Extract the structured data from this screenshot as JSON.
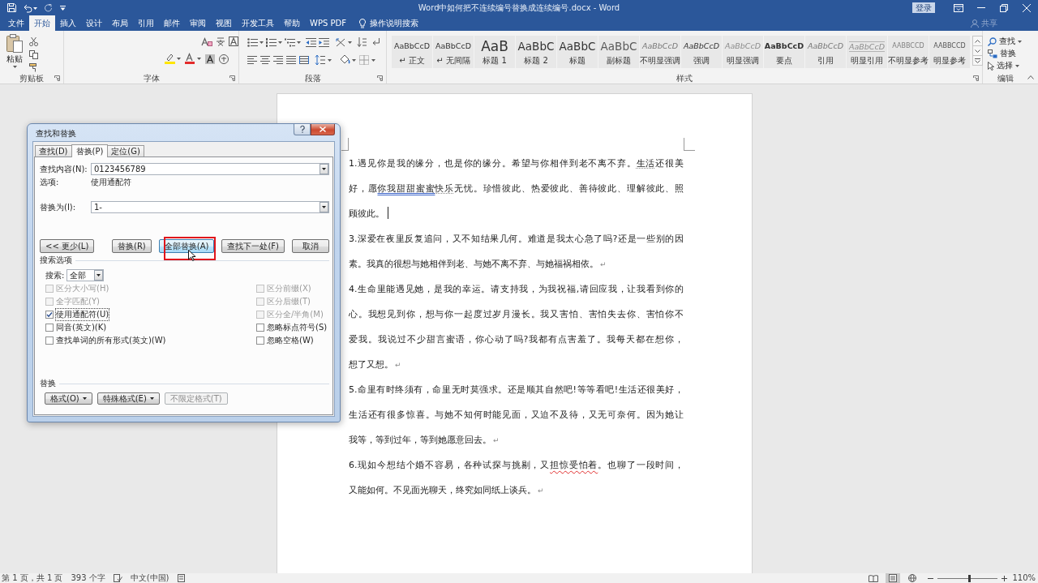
{
  "title_bar": {
    "title": "Word中如何把不连续编号替换成连续编号.docx - Word",
    "sign_in": "登录"
  },
  "ribbon_tabs": [
    {
      "label": "文件",
      "selected": false
    },
    {
      "label": "开始",
      "selected": true
    },
    {
      "label": "插入",
      "selected": false
    },
    {
      "label": "设计",
      "selected": false
    },
    {
      "label": "布局",
      "selected": false
    },
    {
      "label": "引用",
      "selected": false
    },
    {
      "label": "邮件",
      "selected": false
    },
    {
      "label": "审阅",
      "selected": false
    },
    {
      "label": "视图",
      "selected": false
    },
    {
      "label": "开发工具",
      "selected": false
    },
    {
      "label": "帮助",
      "selected": false
    },
    {
      "label": "WPS PDF",
      "selected": false
    }
  ],
  "tell_me": "操作说明搜索",
  "share": "共享",
  "ribbon": {
    "clipboard": {
      "paste": "粘贴",
      "label": "剪贴板"
    },
    "font": {
      "label": "字体"
    },
    "paragraph": {
      "label": "段落"
    },
    "styles": {
      "label": "样式",
      "items": [
        {
          "preview": "AaBbCcD",
          "name": "↵ 正文",
          "kind": "body"
        },
        {
          "preview": "AaBbCcD",
          "name": "↵ 无间隔",
          "kind": "body"
        },
        {
          "preview": "AaB",
          "name": "标题 1",
          "kind": "heading1"
        },
        {
          "preview": "AaBbC",
          "name": "标题 2",
          "kind": "heading2"
        },
        {
          "preview": "AaBbC",
          "name": "标题",
          "kind": "title"
        },
        {
          "preview": "AaBbC",
          "name": "副标题",
          "kind": "subtitle"
        },
        {
          "preview": "AaBbCcD",
          "name": "不明显强调",
          "kind": "subtle-emphasis"
        },
        {
          "preview": "AaBbCcD",
          "name": "强调",
          "kind": "emphasis"
        },
        {
          "preview": "AaBbCcD",
          "name": "明显强调",
          "kind": "intense-emphasis"
        },
        {
          "preview": "AaBbCcD",
          "name": "要点",
          "kind": "strong"
        },
        {
          "preview": "AaBbCcD",
          "name": "引用",
          "kind": "quote"
        },
        {
          "preview": "AaBbCcD",
          "name": "明显引用",
          "kind": "intense-quote"
        },
        {
          "preview": "AABBCCD",
          "name": "不明显参考",
          "kind": "subtle-reference"
        },
        {
          "preview": "AABBCCD",
          "name": "明显参考",
          "kind": "intense-reference"
        }
      ]
    },
    "editing": {
      "label": "编辑",
      "items": [
        {
          "label": "查找",
          "kind": "find",
          "dropdown": true
        },
        {
          "label": "替换",
          "kind": "replace",
          "dropdown": false
        },
        {
          "label": "选择",
          "kind": "select",
          "dropdown": true
        }
      ]
    }
  },
  "document": {
    "paragraphs": [
      {
        "lines": [
          [
            {
              "text": "1.遇见你是我的缘分，也是你的缘分。希望与你相伴到老不离不弃。",
              "kind": "plain"
            },
            {
              "text": "生活",
              "kind": "format"
            },
            {
              "text": "还很美",
              "kind": "plain"
            }
          ],
          [
            {
              "text": "好，愿",
              "kind": "plain"
            },
            {
              "text": "你我甜甜蜜蜜",
              "kind": "grammar"
            },
            {
              "text": "快乐",
              "kind": "format"
            },
            {
              "text": "无忧。珍惜彼此、热爱彼此、善待彼此、理解彼此、照",
              "kind": "plain"
            }
          ],
          [
            {
              "text": "顾彼此。",
              "kind": "plain"
            }
          ]
        ],
        "cursor": true
      },
      {
        "lines": [
          [
            {
              "text": "3.深爱在夜里反复追问，又不知结果几何。难道是我太心急了吗?还是一些别的因",
              "kind": "plain"
            }
          ],
          [
            {
              "text": "素。我真的很想与她相伴到老、与她不离不弃、与她福祸相依。",
              "kind": "plain"
            }
          ]
        ],
        "end_mark": "↵",
        "cursor": false
      },
      {
        "lines": [
          [
            {
              "text": "4.生命里能遇见她，是我的幸运。请支持我，为我祝福,请回应我，让我看到你的",
              "kind": "plain"
            }
          ],
          [
            {
              "text": "心。我想见到你，想与你一起度过岁月漫长。我又害怕、害怕失去你、害怕你不",
              "kind": "plain"
            }
          ],
          [
            {
              "text": "爱我。我说过不少甜言蜜语，你心动了吗?我都有点害羞了。我每天都在想你，",
              "kind": "plain"
            }
          ],
          [
            {
              "text": "想了又想。",
              "kind": "plain"
            }
          ]
        ],
        "end_mark": "↵",
        "cursor": false
      },
      {
        "lines": [
          [
            {
              "text": "5.命里有时终须有，命里无时莫强求。还是顺其自然吧!等等看吧!生活还很美好，",
              "kind": "plain"
            }
          ],
          [
            {
              "text": "生活还有很多惊喜。与她不知何时能见面，又迫不及待，又无可奈何。因为她让",
              "kind": "plain"
            }
          ],
          [
            {
              "text": "我等，等到过年，等到她愿意回去。",
              "kind": "plain"
            }
          ]
        ],
        "end_mark": "↵",
        "cursor": false
      },
      {
        "lines": [
          [
            {
              "text": "6.现如今想结个婚不容易，各种试探与挑剔，又",
              "kind": "plain"
            },
            {
              "text": "担惊受怕着",
              "kind": "spelling"
            },
            {
              "text": "。也聊了一段时间，",
              "kind": "plain"
            }
          ],
          [
            {
              "text": "又能如何。不见面光聊天，终究如同纸上谈兵。",
              "kind": "plain"
            }
          ]
        ],
        "end_mark": "↵",
        "cursor": false
      }
    ]
  },
  "dialog": {
    "title": "查找和替换",
    "tabs": [
      {
        "label": "查找(D)",
        "selected": false
      },
      {
        "label": "替换(P)",
        "selected": true
      },
      {
        "label": "定位(G)",
        "selected": false
      }
    ],
    "find_label": "查找内容(N):",
    "find_value": "0123456789",
    "options_label": "选项:",
    "options_value": "使用通配符",
    "replace_label": "替换为(I):",
    "replace_value": "1-",
    "buttons": [
      {
        "label": "<< 更少(L)",
        "hovered": false,
        "highlighted": false
      },
      {
        "label": "替换(R)",
        "hovered": false,
        "highlighted": false
      },
      {
        "label": "全部替换(A)",
        "hovered": true,
        "highlighted": true
      },
      {
        "label": "查找下一处(F)",
        "hovered": false,
        "highlighted": false
      },
      {
        "label": "取消",
        "hovered": false,
        "highlighted": false
      }
    ],
    "search_options_heading": "搜索选项",
    "search_label": "搜索:",
    "search_value": "全部",
    "left_options": [
      {
        "label": "区分大小写(H)",
        "checked": false,
        "disabled": true,
        "focused": false
      },
      {
        "label": "全字匹配(Y)",
        "checked": false,
        "disabled": true,
        "focused": false
      },
      {
        "label": "使用通配符(U)",
        "checked": true,
        "disabled": false,
        "focused": true
      },
      {
        "label": "同音(英文)(K)",
        "checked": false,
        "disabled": false,
        "focused": false
      },
      {
        "label": "查找单词的所有形式(英文)(W)",
        "checked": false,
        "disabled": false,
        "focused": false
      }
    ],
    "right_options": [
      {
        "label": "区分前缀(X)",
        "checked": false,
        "disabled": true,
        "focused": false
      },
      {
        "label": "区分后缀(T)",
        "checked": false,
        "disabled": true,
        "focused": false
      },
      {
        "label": "区分全/半角(M)",
        "checked": false,
        "disabled": true,
        "focused": false
      },
      {
        "label": "忽略标点符号(S)",
        "checked": false,
        "disabled": false,
        "focused": false
      },
      {
        "label": "忽略空格(W)",
        "checked": false,
        "disabled": false,
        "focused": false
      }
    ],
    "replace_heading": "替换",
    "format_buttons": [
      {
        "label": "格式(O)",
        "dropdown": true,
        "disabled": false
      },
      {
        "label": "特殊格式(E)",
        "dropdown": true,
        "disabled": false
      },
      {
        "label": "不限定格式(T)",
        "dropdown": false,
        "disabled": true
      }
    ]
  },
  "status_bar": {
    "page": "第 1 页，共 1 页",
    "words": "393 个字",
    "language": "中文(中国)",
    "views": [
      {
        "kind": "read",
        "selected": false
      },
      {
        "kind": "print",
        "selected": true
      },
      {
        "kind": "web",
        "selected": false
      }
    ],
    "zoom_slider": {
      "level": 0.52
    },
    "zoom": "110%"
  }
}
